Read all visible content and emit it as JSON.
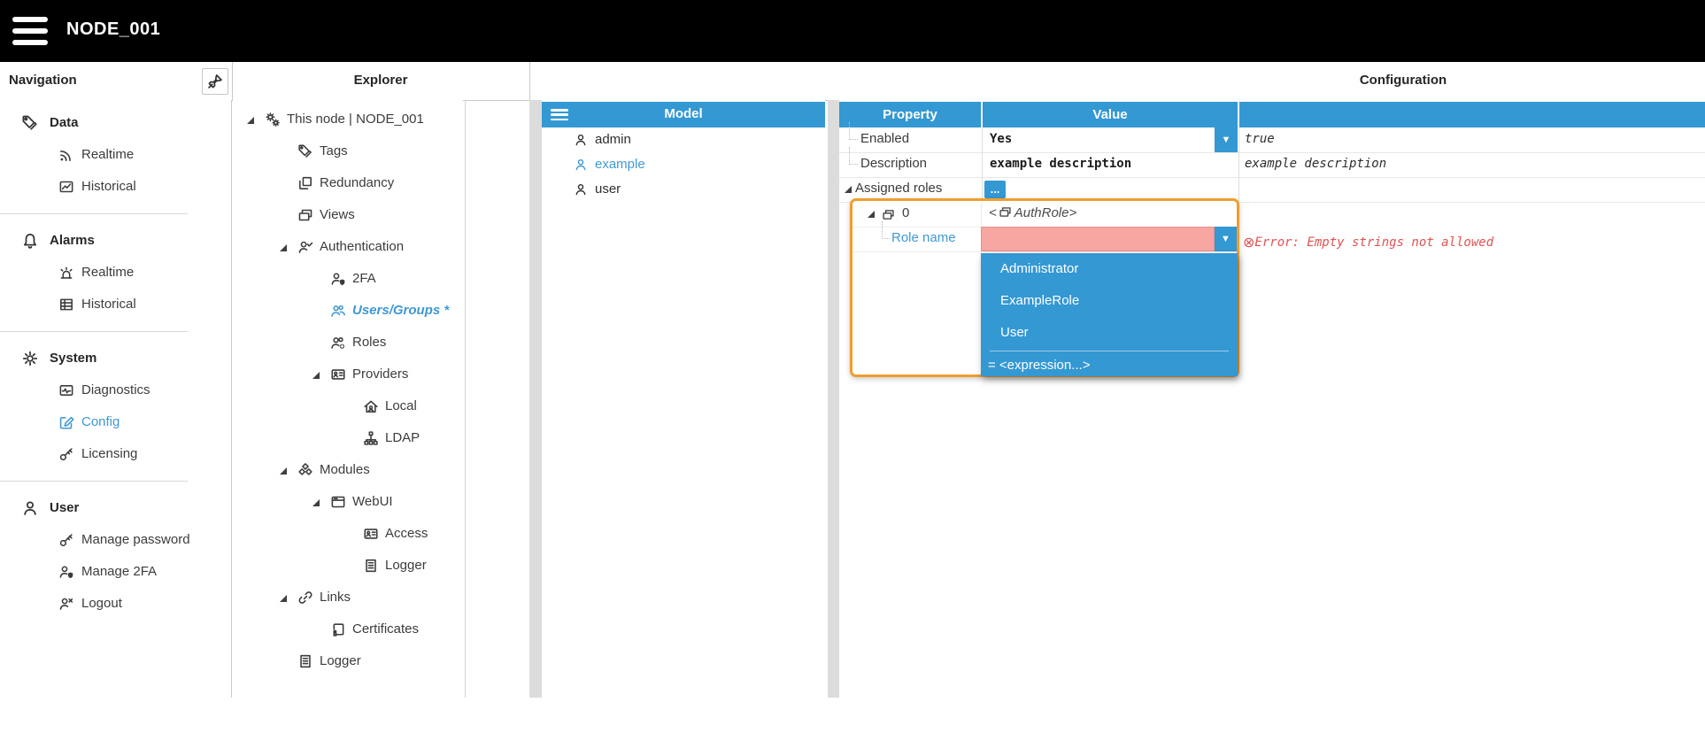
{
  "topbar": {
    "title": "NODE_001"
  },
  "colors": {
    "accent": "#3498d3",
    "highlight_border": "#f09e2e",
    "invalid_bg": "#f7a6a2",
    "error_text": "#e25151",
    "link": "#3f99d4"
  },
  "navigation": {
    "title": "Navigation",
    "groups": [
      {
        "label": "Data",
        "icon": "tags",
        "items": [
          {
            "label": "Realtime",
            "icon": "rss"
          },
          {
            "label": "Historical",
            "icon": "linechart"
          }
        ]
      },
      {
        "label": "Alarms",
        "icon": "bell",
        "items": [
          {
            "label": "Realtime",
            "icon": "siren"
          },
          {
            "label": "Historical",
            "icon": "grid"
          }
        ]
      },
      {
        "label": "System",
        "icon": "gear",
        "items": [
          {
            "label": "Diagnostics",
            "icon": "diagnostics"
          },
          {
            "label": "Config",
            "icon": "edit",
            "active": true
          },
          {
            "label": "Licensing",
            "icon": "key"
          }
        ]
      },
      {
        "label": "User",
        "icon": "person",
        "items": [
          {
            "label": "Manage password",
            "icon": "key"
          },
          {
            "label": "Manage 2FA",
            "icon": "person-shield"
          },
          {
            "label": "Logout",
            "icon": "person-x"
          }
        ]
      }
    ]
  },
  "explorer": {
    "title": "Explorer",
    "tree": [
      {
        "label": "This node | NODE_001",
        "icon": "gears2",
        "level": 0,
        "expanded": true
      },
      {
        "label": "Tags",
        "icon": "tags",
        "level": 1
      },
      {
        "label": "Redundancy",
        "icon": "redundancy",
        "level": 1
      },
      {
        "label": "Views",
        "icon": "views",
        "level": 1
      },
      {
        "label": "Authentication",
        "icon": "person-check",
        "level": 1,
        "expanded": true
      },
      {
        "label": "2FA",
        "icon": "person-shield",
        "level": 2
      },
      {
        "label": "Users/Groups *",
        "icon": "users",
        "level": 2,
        "active": true
      },
      {
        "label": "Roles",
        "icon": "roles",
        "level": 2
      },
      {
        "label": "Providers",
        "icon": "idcard",
        "level": 2,
        "expanded": true
      },
      {
        "label": "Local",
        "icon": "home-person",
        "level": 3
      },
      {
        "label": "LDAP",
        "icon": "hierarchy",
        "level": 3
      },
      {
        "label": "Modules",
        "icon": "modules",
        "level": 1,
        "expanded": true
      },
      {
        "label": "WebUI",
        "icon": "browser",
        "level": 2,
        "expanded": true
      },
      {
        "label": "Access",
        "icon": "idcard",
        "level": 3
      },
      {
        "label": "Logger",
        "icon": "doc",
        "level": 3
      },
      {
        "label": "Links",
        "icon": "link",
        "level": 1,
        "expanded": true
      },
      {
        "label": "Certificates",
        "icon": "certificate",
        "level": 2
      },
      {
        "label": "Logger",
        "icon": "doc",
        "level": 1
      }
    ]
  },
  "model": {
    "title": "Model",
    "items": [
      {
        "label": "admin",
        "icon": "person"
      },
      {
        "label": "example",
        "icon": "person",
        "active": true
      },
      {
        "label": "user",
        "icon": "person"
      }
    ]
  },
  "configuration": {
    "title": "Configuration",
    "columns": {
      "property": "Property",
      "value": "Value"
    },
    "rows": [
      {
        "property": "Enabled",
        "value": "Yes",
        "preview": "true",
        "control": "dropdown"
      },
      {
        "property": "Description",
        "value": "example description",
        "preview": "example description",
        "control": "text"
      },
      {
        "property": "Assigned roles",
        "value": "...",
        "preview": "",
        "control": "more",
        "expanded": true
      }
    ],
    "more_label": "...",
    "role_item": {
      "index": "0",
      "type_open": "<",
      "type_label": "AuthRole",
      "type_close": ">",
      "property": "Role name",
      "value": "",
      "error_icon": "⊗",
      "error": "Error: Empty strings not allowed"
    },
    "dropdown": {
      "items": [
        "Administrator",
        "ExampleRole",
        "User"
      ],
      "expression_label": "= <expression...>"
    }
  }
}
